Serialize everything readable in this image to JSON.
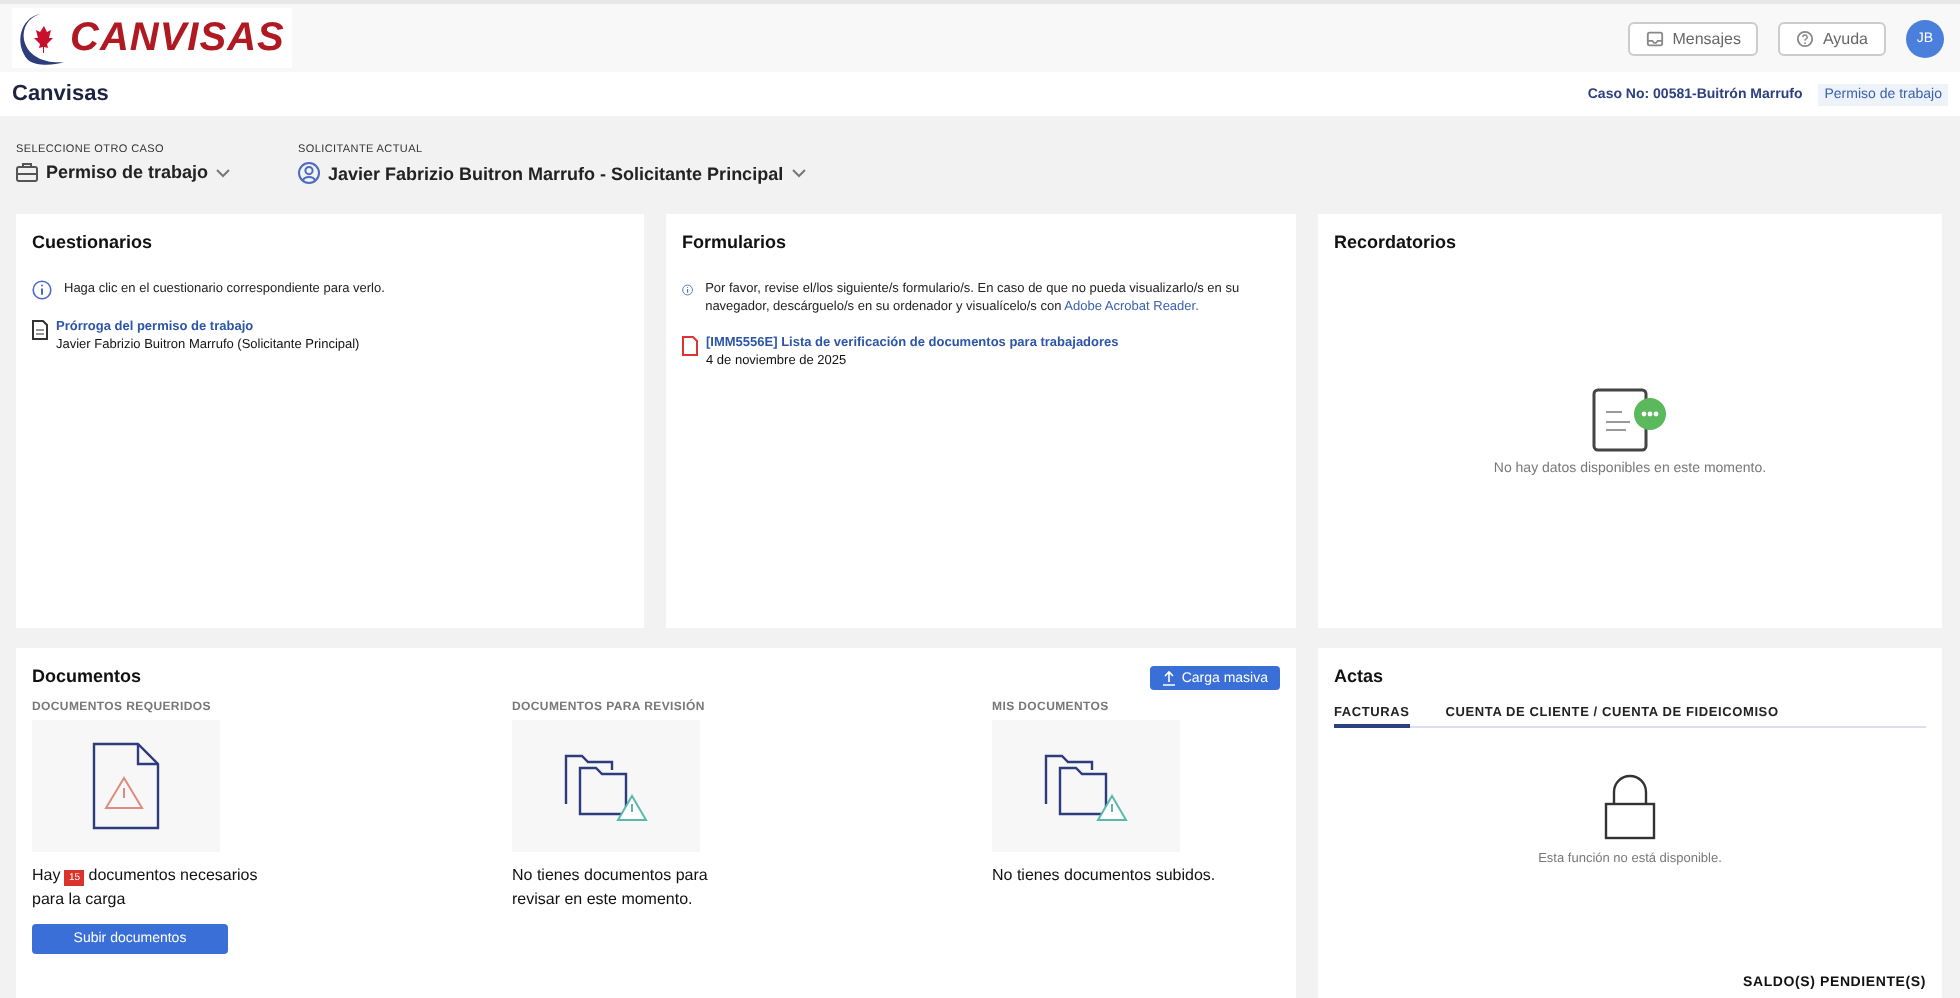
{
  "header": {
    "logo_text": "CANVISAS",
    "buttons": [
      {
        "label": "Mensajes"
      },
      {
        "label": "Ayuda"
      }
    ],
    "avatar": "JB"
  },
  "title_bar": {
    "title": "Canvisas",
    "case_number": "Caso No: 00581-Buitrón Marrufo",
    "case_type": "Permiso de trabajo"
  },
  "selectors": [
    {
      "label": "SELECCIONE OTRO CASO",
      "value": "Permiso de trabajo"
    },
    {
      "label": "SOLICITANTE ACTUAL",
      "value": "Javier Fabrizio Buitron Marrufo - Solicitante Principal"
    }
  ],
  "cuestionarios": {
    "title": "Cuestionarios",
    "info": "Haga clic en el cuestionario correspondiente para verlo.",
    "items": [
      {
        "link": "Prórroga del permiso de trabajo",
        "subtitle": "Javier Fabrizio Buitron Marrufo (Solicitante Principal)"
      }
    ]
  },
  "formularios": {
    "title": "Formularios",
    "info": "Por favor, revise el/los siguiente/s formulario/s. En caso de que no pueda visualizarlo/s en su navegador, descárguelo/s en su ordenador y visualícelo/s con",
    "info_link": "Adobe Acrobat Reader.",
    "items": [
      {
        "link": "[IMM5556E] Lista de verificación de documentos para trabajadores",
        "date": "4 de noviembre de 2025"
      }
    ]
  },
  "recordatorios": {
    "title": "Recordatorios",
    "empty": "No hay datos disponibles en este momento."
  },
  "documentos": {
    "title": "Documentos",
    "bulk_button": "Carga masiva",
    "sections": [
      {
        "kind": "required",
        "label": "DOCUMENTOS REQUERIDOS",
        "text_before": "Hay",
        "count": "15",
        "text_after": "documentos necesarios para la carga",
        "button": "Subir documentos"
      },
      {
        "kind": "review",
        "label": "DOCUMENTOS PARA REVISIÓN",
        "text": "No tienes documentos para revisar en este momento."
      },
      {
        "kind": "mine",
        "label": "MIS DOCUMENTOS",
        "text": "No tienes documentos subidos."
      }
    ]
  },
  "actas": {
    "title": "Actas",
    "tabs": [
      {
        "label": "FACTURAS",
        "selected": true
      },
      {
        "label": "CUENTA DE CLIENTE / CUENTA DE FIDEICOMISO",
        "selected": false
      }
    ],
    "locked_text": "Esta función no está disponible.",
    "footer": "SALDO(S) PENDIENTE(S)"
  }
}
